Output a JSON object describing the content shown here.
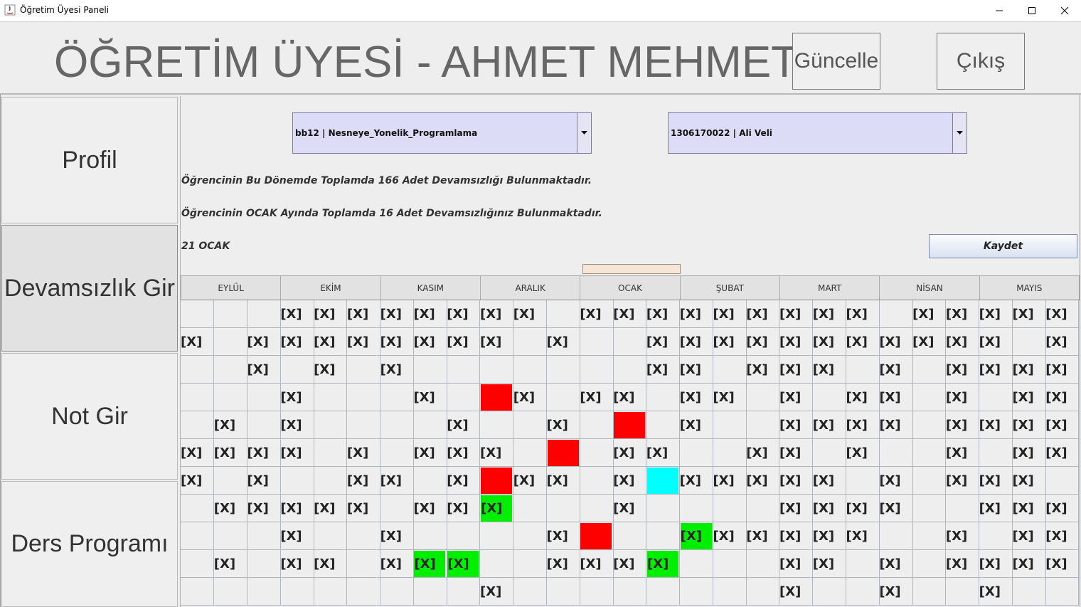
{
  "window": {
    "title": "Öğretim Üyesi Paneli"
  },
  "header": {
    "title": "ÖĞRETİM ÜYESİ - AHMET MEHMET",
    "update_label": "Güncelle",
    "exit_label": "Çıkış"
  },
  "sidebar": {
    "items": [
      {
        "label": "Profil",
        "active": false
      },
      {
        "label": "Devamsızlık Gir",
        "active": true
      },
      {
        "label": "Not Gir",
        "active": false
      },
      {
        "label": "Ders Programı",
        "active": false
      }
    ]
  },
  "course_select": {
    "value": "bb12 | Nesneye_Yonelik_Programlama"
  },
  "student_select": {
    "value": "1306170022 | Ali Veli"
  },
  "info": {
    "total_line": "Öğrencinin Bu Dönemde Toplamda 166 Adet Devamsızlığı Bulunmaktadır.",
    "month_line": "Öğrencinin OCAK Ayında Toplamda 16 Adet Devamsızlığınız Bulunmaktadır.",
    "selected_date": "21 OCAK"
  },
  "save_label": "Kaydet",
  "colors": {
    "red": "#ff0000",
    "green": "#00ee00",
    "cyan": "#00ffff"
  },
  "mark_text": "[X]",
  "months": [
    "EYLÜL",
    "EKİM",
    "KASIM",
    "ARALIK",
    "OCAK",
    "ŞUBAT",
    "MART",
    "NİSAN",
    "MAYIS"
  ],
  "grid": [
    [
      0,
      0,
      0,
      1,
      1,
      1,
      1,
      1,
      1,
      1,
      1,
      0,
      1,
      1,
      1,
      1,
      1,
      1,
      1,
      1,
      1,
      0,
      1,
      1,
      1,
      1,
      1
    ],
    [
      1,
      0,
      1,
      1,
      1,
      1,
      1,
      1,
      1,
      1,
      0,
      1,
      0,
      0,
      1,
      1,
      1,
      1,
      1,
      1,
      1,
      1,
      1,
      1,
      1,
      0,
      1
    ],
    [
      0,
      0,
      1,
      0,
      1,
      0,
      1,
      0,
      0,
      0,
      0,
      0,
      0,
      0,
      1,
      1,
      0,
      1,
      1,
      1,
      0,
      1,
      0,
      1,
      1,
      1,
      1
    ],
    [
      0,
      0,
      0,
      1,
      0,
      0,
      0,
      1,
      0,
      "r",
      1,
      0,
      1,
      1,
      0,
      1,
      1,
      0,
      1,
      0,
      1,
      1,
      0,
      1,
      0,
      1,
      1
    ],
    [
      0,
      1,
      0,
      1,
      0,
      0,
      0,
      0,
      1,
      0,
      0,
      1,
      0,
      "r",
      0,
      1,
      0,
      0,
      1,
      1,
      1,
      1,
      0,
      1,
      1,
      1,
      1
    ],
    [
      1,
      1,
      1,
      1,
      0,
      1,
      0,
      1,
      1,
      1,
      0,
      "r",
      0,
      1,
      1,
      0,
      0,
      1,
      1,
      0,
      1,
      0,
      0,
      1,
      0,
      1,
      1
    ],
    [
      1,
      0,
      1,
      0,
      0,
      1,
      1,
      0,
      1,
      "r",
      1,
      1,
      0,
      1,
      "c",
      1,
      1,
      1,
      1,
      1,
      0,
      1,
      0,
      1,
      1,
      1,
      0
    ],
    [
      0,
      1,
      1,
      1,
      1,
      1,
      0,
      1,
      1,
      "g",
      0,
      0,
      0,
      1,
      0,
      0,
      0,
      0,
      1,
      1,
      1,
      1,
      0,
      0,
      1,
      1,
      1
    ],
    [
      0,
      0,
      0,
      1,
      0,
      0,
      1,
      0,
      0,
      0,
      0,
      1,
      "r",
      0,
      0,
      "g",
      1,
      1,
      1,
      1,
      1,
      0,
      0,
      1,
      0,
      1,
      1
    ],
    [
      0,
      1,
      0,
      1,
      1,
      0,
      1,
      "g",
      "g",
      0,
      0,
      1,
      1,
      1,
      "g",
      0,
      0,
      0,
      1,
      1,
      0,
      1,
      0,
      1,
      1,
      1,
      1
    ],
    [
      0,
      0,
      0,
      0,
      0,
      0,
      0,
      0,
      0,
      1,
      0,
      0,
      0,
      0,
      0,
      0,
      0,
      0,
      1,
      0,
      0,
      1,
      0,
      0,
      1,
      0,
      0
    ]
  ]
}
